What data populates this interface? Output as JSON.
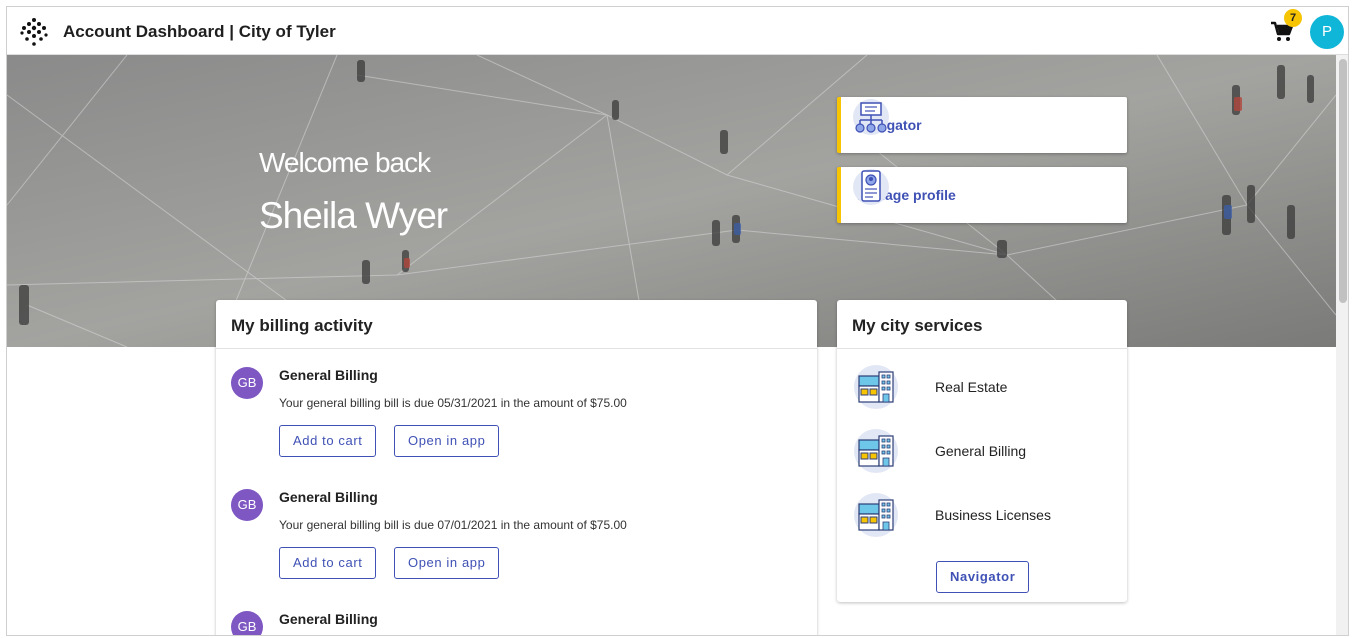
{
  "header": {
    "title": "Account Dashboard | City of Tyler",
    "cart_count": "7",
    "avatar_initial": "P"
  },
  "hero": {
    "welcome": "Welcome back",
    "user_name": "Sheila Wyer"
  },
  "quick_links": [
    {
      "label": "Navigator",
      "icon": "org-chart-icon"
    },
    {
      "label": "Manage profile",
      "icon": "profile-card-icon"
    }
  ],
  "billing": {
    "title": "My billing activity",
    "items": [
      {
        "initials": "GB",
        "title": "General Billing",
        "description": "Your general billing bill is due 05/31/2021 in the amount of $75.00",
        "add_label": "Add to cart",
        "open_label": "Open in app"
      },
      {
        "initials": "GB",
        "title": "General Billing",
        "description": "Your general billing bill is due 07/01/2021 in the amount of $75.00",
        "add_label": "Add to cart",
        "open_label": "Open in app"
      },
      {
        "initials": "GB",
        "title": "General Billing"
      }
    ]
  },
  "services": {
    "title": "My city services",
    "items": [
      {
        "label": "Real Estate",
        "icon": "building-icon"
      },
      {
        "label": "General Billing",
        "icon": "building-icon"
      },
      {
        "label": "Business Licenses",
        "icon": "building-icon"
      }
    ],
    "navigator_label": "Navigator"
  },
  "colors": {
    "accent": "#3f51b5",
    "highlight": "#f6c400",
    "avatar": "#7e57c2",
    "user_avatar": "#10b6d8"
  }
}
